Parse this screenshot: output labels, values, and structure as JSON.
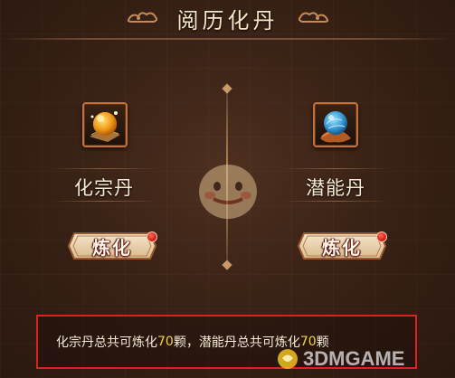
{
  "title": "阅历化丹",
  "items": [
    {
      "name": "化宗丹",
      "icon": "golden-pill-icon",
      "button_label": "炼化",
      "has_notification": true
    },
    {
      "name": "潜能丹",
      "icon": "blue-pill-icon",
      "button_label": "炼化",
      "has_notification": true
    }
  ],
  "info": {
    "text_1": "化宗丹总共可炼化",
    "count_1": "70",
    "text_2": "颗，潜能丹总共可炼化",
    "count_2": "70",
    "text_3": "颗"
  },
  "watermark": "3DMGAME",
  "colors": {
    "highlight_number": "#f2d34a",
    "annotation_border": "#e0201c",
    "notification_dot": "#d21a12"
  }
}
